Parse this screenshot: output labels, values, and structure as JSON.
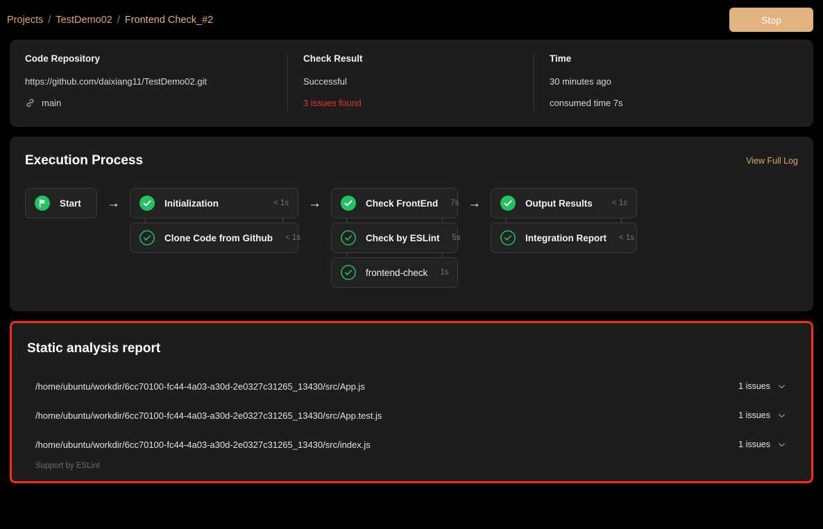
{
  "breadcrumb": {
    "items": [
      {
        "label": "Projects"
      },
      {
        "label": "TestDemo02"
      },
      {
        "label": "Frontend Check_#2"
      }
    ],
    "separator": "/"
  },
  "header": {
    "stop_label": "Stop",
    "accent_color": "#e0a566",
    "stop_bg_color": "#e2b37e"
  },
  "summary": {
    "repository": {
      "title": "Code Repository",
      "url": "https://github.com/daixiang11/TestDemo02.git",
      "branch": "main",
      "branch_icon": "link-icon"
    },
    "check_result": {
      "title": "Check Result",
      "status": "Successful",
      "issues": "3 issues found",
      "issues_color": "#e8352b"
    },
    "time": {
      "title": "Time",
      "relative": "30 minutes ago",
      "consumed": "consumed time 7s"
    }
  },
  "execution": {
    "title": "Execution Process",
    "view_full_log": "View Full Log",
    "arrow": "→",
    "groups": [
      {
        "nodes": [
          {
            "name": "Start",
            "duration": "",
            "icon": "flag-icon",
            "icon_style": "filled",
            "bold": true
          }
        ]
      },
      {
        "nodes": [
          {
            "name": "Initialization",
            "duration": "< 1s",
            "icon": "check-circle-icon",
            "icon_style": "filled",
            "bold": true
          },
          {
            "name": "Clone Code from Github",
            "duration": "< 1s",
            "icon": "check-circle-icon",
            "icon_style": "outline",
            "bold": true
          }
        ]
      },
      {
        "nodes": [
          {
            "name": "Check FrontEnd",
            "duration": "7s",
            "icon": "check-circle-icon",
            "icon_style": "filled",
            "bold": true
          },
          {
            "name": "Check by ESLint",
            "duration": "5s",
            "icon": "check-circle-icon",
            "icon_style": "outline",
            "bold": true
          },
          {
            "name": "frontend-check",
            "duration": "1s",
            "icon": "check-circle-icon",
            "icon_style": "outline",
            "bold": false
          }
        ]
      },
      {
        "nodes": [
          {
            "name": "Output Results",
            "duration": "< 1s",
            "icon": "check-circle-icon",
            "icon_style": "filled",
            "bold": true
          },
          {
            "name": "Integration Report",
            "duration": "< 1s",
            "icon": "check-circle-icon",
            "icon_style": "outline",
            "bold": true
          }
        ]
      }
    ],
    "success_color": "#22c35e"
  },
  "report": {
    "title": "Static analysis report",
    "highlight_color": "#fd2a16",
    "footer": "Support by ESLint",
    "rows": [
      {
        "path": "/home/ubuntu/workdir/6cc70100-fc44-4a03-a30d-2e0327c31265_13430/src/App.js",
        "issues": "1 issues",
        "chevron": "chevron-down-icon"
      },
      {
        "path": "/home/ubuntu/workdir/6cc70100-fc44-4a03-a30d-2e0327c31265_13430/src/App.test.js",
        "issues": "1 issues",
        "chevron": "chevron-down-icon"
      },
      {
        "path": "/home/ubuntu/workdir/6cc70100-fc44-4a03-a30d-2e0327c31265_13430/src/index.js",
        "issues": "1 issues",
        "chevron": "chevron-down-icon"
      }
    ]
  }
}
